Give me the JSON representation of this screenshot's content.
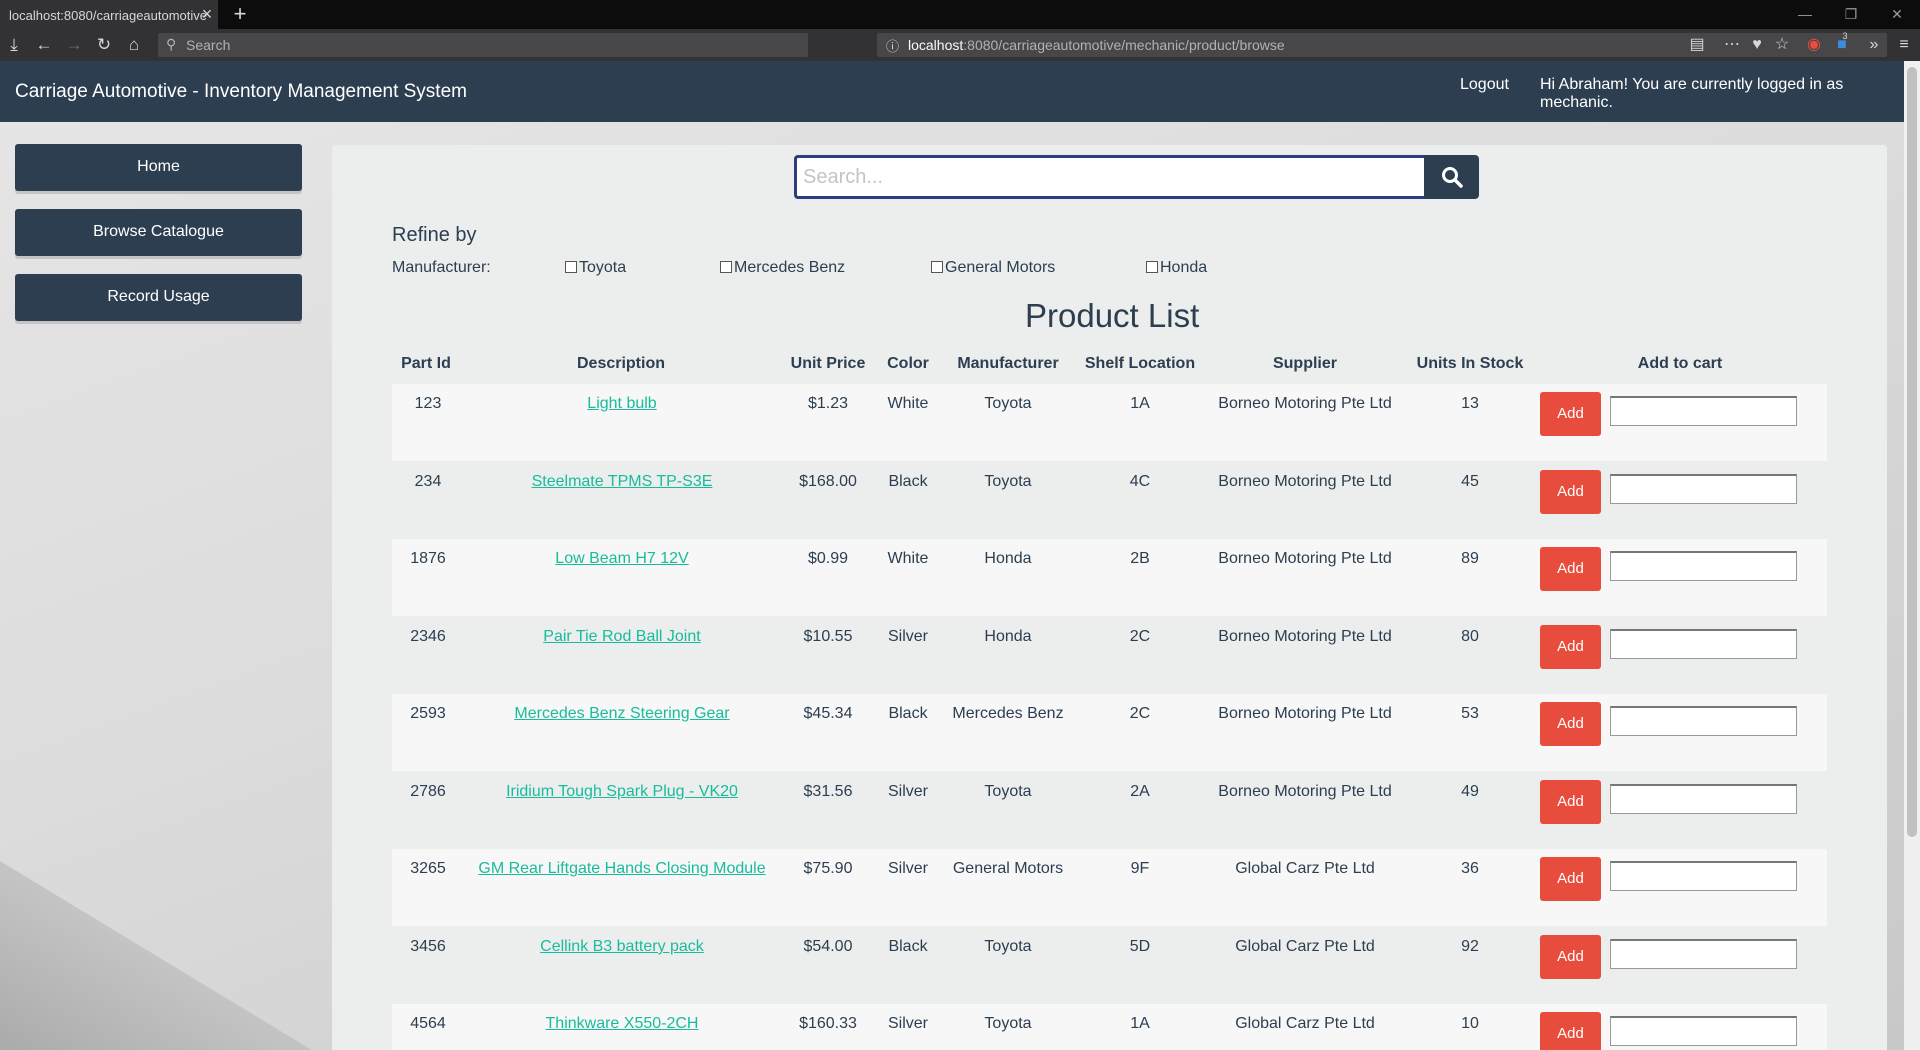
{
  "browser": {
    "tab_title": "localhost:8080/carriageautomotive",
    "search_placeholder": "Search",
    "url_host": "localhost",
    "url_rest": ":8080/carriageautomotive/mechanic/product/browse",
    "badge_count": "3"
  },
  "app": {
    "title": "Carriage Automotive - Inventory Management System",
    "logout": "Logout",
    "greeting": "Hi Abraham! You are currently logged in as mechanic."
  },
  "sidebar": {
    "items": [
      {
        "label": "Home"
      },
      {
        "label": "Browse Catalogue"
      },
      {
        "label": "Record Usage"
      }
    ]
  },
  "search": {
    "placeholder": "Search..."
  },
  "refine": {
    "title": "Refine by",
    "manufacturer_label": "Manufacturer:",
    "options": [
      "Toyota",
      "Mercedes Benz",
      "General Motors",
      "Honda"
    ]
  },
  "product_list": {
    "title": "Product List",
    "columns": [
      "Part Id",
      "Description",
      "Unit Price",
      "Color",
      "Manufacturer",
      "Shelf Location",
      "Supplier",
      "Units In Stock",
      "Add to cart"
    ],
    "add_label": "Add",
    "rows": [
      {
        "id": "123",
        "desc": "Light bulb",
        "price": "$1.23",
        "color": "White",
        "mfr": "Toyota",
        "shelf": "1A",
        "supplier": "Borneo Motoring Pte Ltd",
        "stock": "13"
      },
      {
        "id": "234",
        "desc": "Steelmate TPMS TP-S3E",
        "price": "$168.00",
        "color": "Black",
        "mfr": "Toyota",
        "shelf": "4C",
        "supplier": "Borneo Motoring Pte Ltd",
        "stock": "45"
      },
      {
        "id": "1876",
        "desc": "Low Beam H7 12V",
        "price": "$0.99",
        "color": "White",
        "mfr": "Honda",
        "shelf": "2B",
        "supplier": "Borneo Motoring Pte Ltd",
        "stock": "89"
      },
      {
        "id": "2346",
        "desc": "Pair Tie Rod Ball Joint",
        "price": "$10.55",
        "color": "Silver",
        "mfr": "Honda",
        "shelf": "2C",
        "supplier": "Borneo Motoring Pte Ltd",
        "stock": "80"
      },
      {
        "id": "2593",
        "desc": "Mercedes Benz Steering Gear",
        "price": "$45.34",
        "color": "Black",
        "mfr": "Mercedes Benz",
        "shelf": "2C",
        "supplier": "Borneo Motoring Pte Ltd",
        "stock": "53"
      },
      {
        "id": "2786",
        "desc": "Iridium Tough Spark Plug - VK20",
        "price": "$31.56",
        "color": "Silver",
        "mfr": "Toyota",
        "shelf": "2A",
        "supplier": "Borneo Motoring Pte Ltd",
        "stock": "49"
      },
      {
        "id": "3265",
        "desc": "GM Rear Liftgate Hands Closing Module",
        "price": "$75.90",
        "color": "Silver",
        "mfr": "General Motors",
        "shelf": "9F",
        "supplier": "Global Carz Pte Ltd",
        "stock": "36"
      },
      {
        "id": "3456",
        "desc": "Cellink B3 battery pack",
        "price": "$54.00",
        "color": "Black",
        "mfr": "Toyota",
        "shelf": "5D",
        "supplier": "Global Carz Pte Ltd",
        "stock": "92"
      },
      {
        "id": "4564",
        "desc": "Thinkware X550-2CH",
        "price": "$160.33",
        "color": "Silver",
        "mfr": "Toyota",
        "shelf": "1A",
        "supplier": "Global Carz Pte Ltd",
        "stock": "10"
      }
    ]
  },
  "colors": {
    "header_bg": "#2c3e50",
    "link": "#18bc9c",
    "add_button": "#e74c3c"
  }
}
